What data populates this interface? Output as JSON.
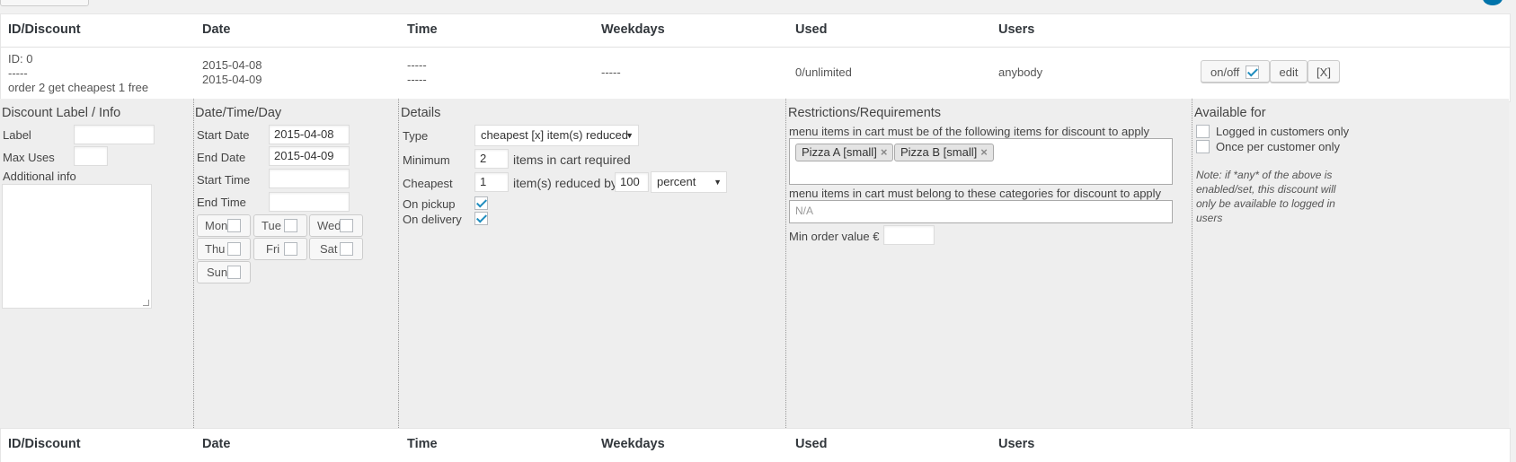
{
  "columns": {
    "id_discount": "ID/Discount",
    "date": "Date",
    "time": "Time",
    "weekdays": "Weekdays",
    "used": "Used",
    "users": "Users"
  },
  "row": {
    "id_line": "ID: 0",
    "dashes": "-----",
    "name": "order 2 get cheapest 1 free",
    "date_start": "2015-04-08",
    "date_end": "2015-04-09",
    "time_start": "-----",
    "time_end": "-----",
    "weekdays": "-----",
    "used": "0/unlimited",
    "users": "anybody",
    "onoff_label": "on/off",
    "onoff_checked": true,
    "edit_label": "edit",
    "delete_label": "[X]"
  },
  "label_section": {
    "title": "Discount Label / Info",
    "label_label": "Label",
    "label_value": "",
    "max_uses_label": "Max Uses",
    "max_uses_value": "",
    "additional_info_label": "Additional info",
    "additional_info_value": ""
  },
  "datetime_section": {
    "title": "Date/Time/Day",
    "start_date_label": "Start Date",
    "start_date_value": "2015-04-08",
    "end_date_label": "End Date",
    "end_date_value": "2015-04-09",
    "start_time_label": "Start Time",
    "start_time_value": "",
    "end_time_label": "End Time",
    "end_time_value": "",
    "days": [
      {
        "label": "Mon",
        "checked": false
      },
      {
        "label": "Tue",
        "checked": false
      },
      {
        "label": "Wed",
        "checked": false
      },
      {
        "label": "Thu",
        "checked": false
      },
      {
        "label": "Fri",
        "checked": false
      },
      {
        "label": "Sat",
        "checked": false
      },
      {
        "label": "Sun",
        "checked": false
      }
    ]
  },
  "details_section": {
    "title": "Details",
    "type_label": "Type",
    "type_value": "cheapest [x] item(s) reduced",
    "minimum_label": "Minimum",
    "minimum_value": "2",
    "minimum_suffix": "items in cart required",
    "cheapest_label": "Cheapest",
    "cheapest_value": "1",
    "cheapest_suffix": "item(s) reduced by",
    "reduced_by_value": "100",
    "reduction_unit": "percent",
    "on_pickup_label": "On pickup",
    "on_pickup_checked": true,
    "on_delivery_label": "On delivery",
    "on_delivery_checked": true
  },
  "restrictions_section": {
    "title": "Restrictions/Requirements",
    "items_label": "menu items in cart must be of the following items for discount to apply",
    "items": [
      "Pizza A [small]",
      "Pizza B [small]"
    ],
    "categories_label": "menu items in cart must belong to these categories for discount to apply",
    "categories_placeholder": "N/A",
    "min_order_label": "Min order value €",
    "min_order_value": ""
  },
  "available_section": {
    "title": "Available for",
    "logged_in_label": "Logged in customers only",
    "logged_in_checked": false,
    "once_per_customer_label": "Once per customer only",
    "once_per_customer_checked": false,
    "note": "Note: if *any* of the above is enabled/set, this discount will only be available to logged in users"
  }
}
